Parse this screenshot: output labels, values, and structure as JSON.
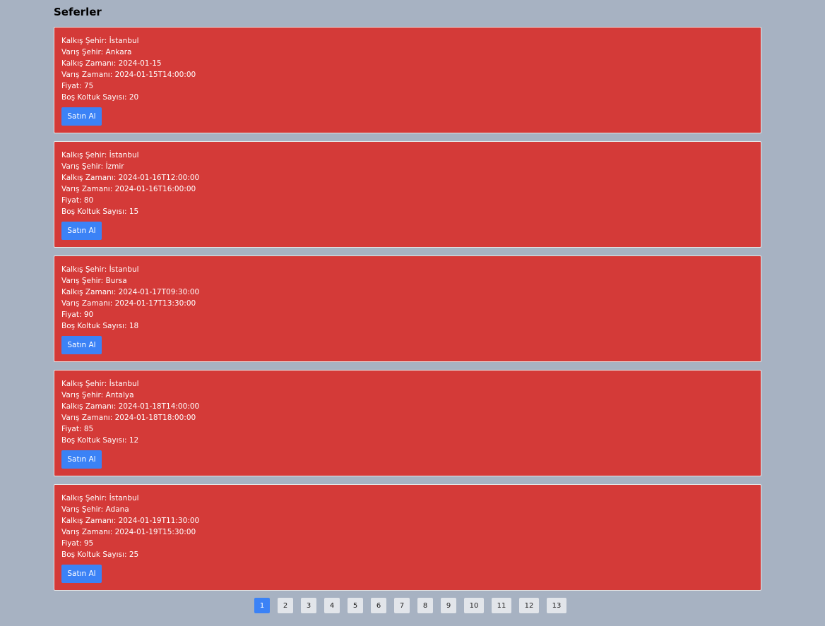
{
  "title": "Seferler",
  "trips": [
    {
      "from": "Kalkış Şehir: İstanbul",
      "to": "Varış Şehir: Ankara",
      "departure": "Kalkış Zamanı: 2024-01-15",
      "arrival": "Varış Zamanı: 2024-01-15T14:00:00",
      "price": "Fiyat: 75",
      "seats": "Boş Koltuk Sayısı: 20",
      "button": "Satın Al"
    },
    {
      "from": "Kalkış Şehir: İstanbul",
      "to": "Varış Şehir: İzmir",
      "departure": "Kalkış Zamanı: 2024-01-16T12:00:00",
      "arrival": "Varış Zamanı: 2024-01-16T16:00:00",
      "price": "Fiyat: 80",
      "seats": "Boş Koltuk Sayısı: 15",
      "button": "Satın Al"
    },
    {
      "from": "Kalkış Şehir: İstanbul",
      "to": "Varış Şehir: Bursa",
      "departure": "Kalkış Zamanı: 2024-01-17T09:30:00",
      "arrival": "Varış Zamanı: 2024-01-17T13:30:00",
      "price": "Fiyat: 90",
      "seats": "Boş Koltuk Sayısı: 18",
      "button": "Satın Al"
    },
    {
      "from": "Kalkış Şehir: İstanbul",
      "to": "Varış Şehir: Antalya",
      "departure": "Kalkış Zamanı: 2024-01-18T14:00:00",
      "arrival": "Varış Zamanı: 2024-01-18T18:00:00",
      "price": "Fiyat: 85",
      "seats": "Boş Koltuk Sayısı: 12",
      "button": "Satın Al"
    },
    {
      "from": "Kalkış Şehir: İstanbul",
      "to": "Varış Şehir: Adana",
      "departure": "Kalkış Zamanı: 2024-01-19T11:30:00",
      "arrival": "Varış Zamanı: 2024-01-19T15:30:00",
      "price": "Fiyat: 95",
      "seats": "Boş Koltuk Sayısı: 25",
      "button": "Satın Al"
    }
  ],
  "pagination": {
    "pages": [
      "1",
      "2",
      "3",
      "4",
      "5",
      "6",
      "7",
      "8",
      "9",
      "10",
      "11",
      "12",
      "13"
    ],
    "current": "1"
  },
  "colors": {
    "background": "#a7b2c2",
    "card": "#d43a38",
    "button": "#3b82f6",
    "page_button": "#e2e5ea"
  }
}
